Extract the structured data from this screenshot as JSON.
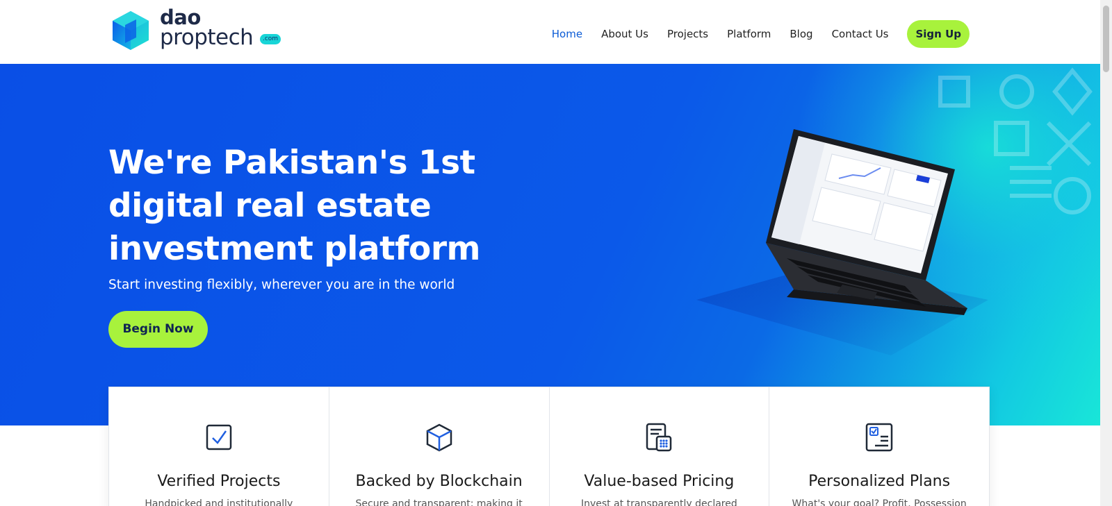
{
  "logo": {
    "line1": "dao",
    "line2": "proptech",
    "badge": ".com"
  },
  "nav": {
    "items": [
      {
        "label": "Home",
        "active": true
      },
      {
        "label": "About Us"
      },
      {
        "label": "Projects"
      },
      {
        "label": "Platform"
      },
      {
        "label": "Blog"
      },
      {
        "label": "Contact Us"
      }
    ],
    "signup_label": "Sign Up"
  },
  "hero": {
    "title_line1": "We're Pakistan's 1st",
    "title_line2": "digital real estate",
    "title_line3": "investment platform",
    "subtitle": "Start investing flexibly, wherever you are in the world",
    "cta_label": "Begin Now"
  },
  "features": [
    {
      "title": "Verified Projects",
      "desc": "Handpicked and institutionally",
      "icon": "checkbox-icon"
    },
    {
      "title": "Backed by Blockchain",
      "desc": "Secure and transparent; making it",
      "icon": "cube-icon"
    },
    {
      "title": "Value-based Pricing",
      "desc": "Invest at transparently declared",
      "icon": "calculator-icon"
    },
    {
      "title": "Personalized Plans",
      "desc": "What's your goal? Profit, Possession",
      "icon": "checklist-icon"
    }
  ],
  "colors": {
    "accent": "#a8f23c",
    "brand_blue": "#0a4fe6",
    "teal": "#19e6d8",
    "nav_active": "#0b5bd6"
  }
}
